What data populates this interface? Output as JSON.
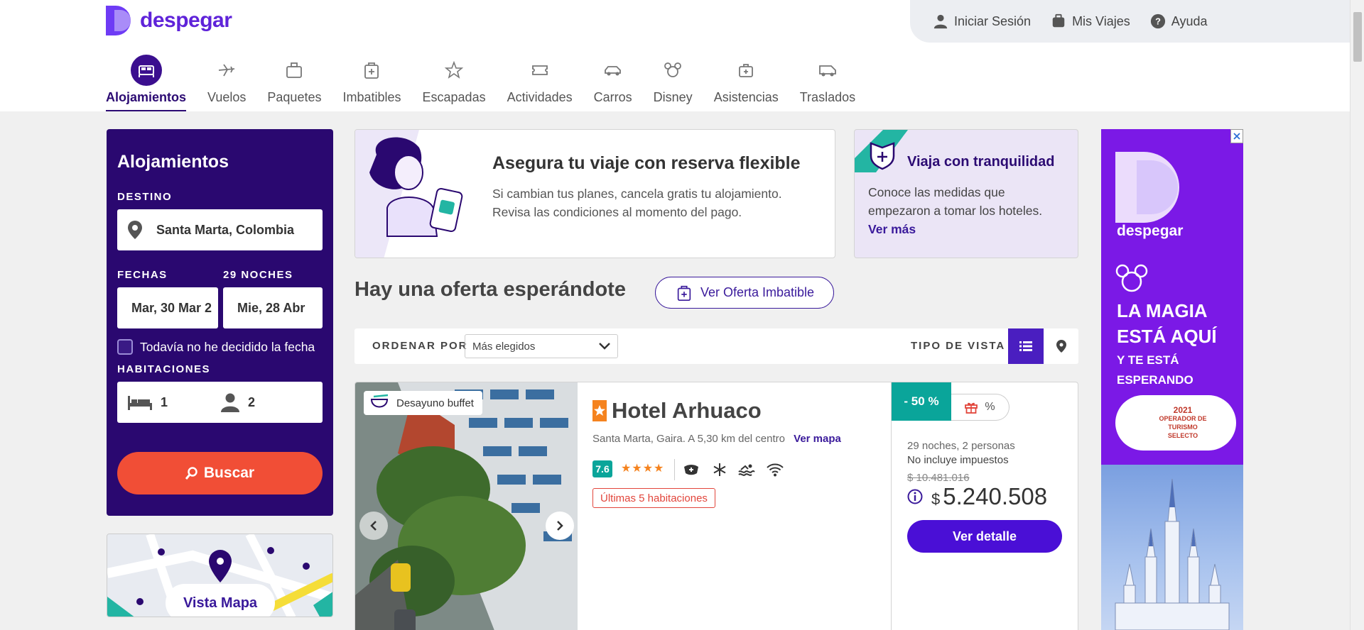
{
  "brand": {
    "logo_text": "despegar",
    "accent": "#5f23d9",
    "dark": "#2a0870"
  },
  "account": {
    "login": "Iniciar Sesión",
    "trips": "Mis Viajes",
    "help": "Ayuda"
  },
  "nav": [
    {
      "label": "Alojamientos",
      "icon": "bed-icon",
      "active": true
    },
    {
      "label": "Vuelos",
      "icon": "plane-icon"
    },
    {
      "label": "Paquetes",
      "icon": "suitcase-icon"
    },
    {
      "label": "Imbatibles",
      "icon": "tag-icon"
    },
    {
      "label": "Escapadas",
      "icon": "star-plane-icon"
    },
    {
      "label": "Actividades",
      "icon": "ticket-icon"
    },
    {
      "label": "Carros",
      "icon": "car-icon"
    },
    {
      "label": "Disney",
      "icon": "mickey-icon"
    },
    {
      "label": "Asistencias",
      "icon": "medkit-icon"
    },
    {
      "label": "Traslados",
      "icon": "van-icon"
    }
  ],
  "search": {
    "title": "Alojamientos",
    "destination_label": "DESTINO",
    "destination_value": "Santa Marta, Colombia",
    "dates_label": "FECHAS",
    "nights_label": "29 NOCHES",
    "checkin": "Mar, 30 Mar 2",
    "checkout": "Mie, 28 Abr",
    "undecided_label": "Todavía no he decidido la fecha",
    "rooms_label": "HABITACIONES",
    "rooms": "1",
    "guests": "2",
    "button": "Buscar"
  },
  "map_card": {
    "button": "Vista Mapa"
  },
  "promo_flexible": {
    "title": "Asegura tu viaje con reserva flexible",
    "text": "Si cambian tus planes, cancela gratis tu alojamiento. Revisa las condiciones al momento del pago."
  },
  "promo_safety": {
    "title": "Viaja con tranquilidad",
    "text": "Conoce las medidas que empezaron a tomar los hoteles.",
    "link": "Ver más"
  },
  "offer": {
    "title": "Hay una oferta esperándote",
    "button": "Ver Oferta Imbatible"
  },
  "sort": {
    "label": "ORDENAR POR",
    "selected": "Más elegidos",
    "view_label": "TIPO DE VISTA"
  },
  "hotel": {
    "badge": "Desayuno buffet",
    "name": "Hotel Arhuaco",
    "location": "Santa Marta, Gaira. A 5,30 km del centro",
    "map_link": "Ver mapa",
    "rating": "7.6",
    "stars": "★★★★",
    "last_rooms": "Últimas 5 habitaciones",
    "discount": "- 50 %",
    "gift_percent": "%",
    "nights_people": "29 noches, 2 personas",
    "taxes": "No incluye impuestos",
    "old_price": "$ 10.481.016",
    "currency": "$",
    "price": "5.240.508",
    "detail_button": "Ver detalle"
  },
  "ad": {
    "brand": "despegar",
    "headline": "LA MAGIA ESTÁ AQUÍ",
    "sub": "Y TE ESTÁ ESPERANDO",
    "badge_year": "2021",
    "badge_text": "OPERADOR DE TURISMO SELECTO"
  }
}
